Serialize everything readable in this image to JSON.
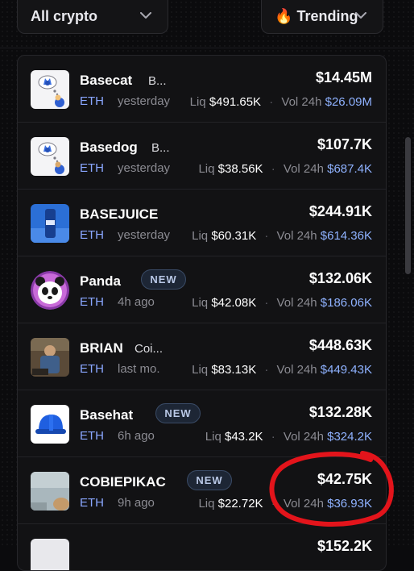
{
  "filters": {
    "crypto": {
      "label": "All crypto",
      "icon": "chevron-down-icon"
    },
    "sort": {
      "emoji": "🔥",
      "label": "Trending",
      "icon": "chevron-down-icon"
    }
  },
  "labels": {
    "liq": "Liq",
    "vol": "Vol 24h"
  },
  "tokens": [
    {
      "name": "Basecat",
      "tagline": "B...",
      "chain": "ETH",
      "age": "yesterday",
      "market_cap": "$14.45M",
      "liq": "$491.65K",
      "vol24h": "$26.09M",
      "is_new": false,
      "avatar_icon": "basecat-avatar-icon"
    },
    {
      "name": "Basedog",
      "tagline": "B...",
      "chain": "ETH",
      "age": "yesterday",
      "market_cap": "$107.7K",
      "liq": "$38.56K",
      "vol24h": "$687.4K",
      "is_new": false,
      "avatar_icon": "basedog-avatar-icon"
    },
    {
      "name": "BASEJUICE",
      "tagline": "",
      "chain": "ETH",
      "age": "yesterday",
      "market_cap": "$244.91K",
      "liq": "$60.31K",
      "vol24h": "$614.36K",
      "is_new": false,
      "avatar_icon": "basejuice-avatar-icon"
    },
    {
      "name": "Panda",
      "tagline": "",
      "chain": "ETH",
      "age": "4h ago",
      "market_cap": "$132.06K",
      "liq": "$42.08K",
      "vol24h": "$186.06K",
      "is_new": true,
      "badge": "NEW",
      "avatar_icon": "panda-avatar-icon"
    },
    {
      "name": "BRIAN",
      "tagline": "Coi...",
      "chain": "ETH",
      "age": "last mo.",
      "market_cap": "$448.63K",
      "liq": "$83.13K",
      "vol24h": "$449.43K",
      "is_new": false,
      "avatar_icon": "brian-avatar-icon"
    },
    {
      "name": "Basehat",
      "tagline": "",
      "chain": "ETH",
      "age": "6h ago",
      "market_cap": "$132.28K",
      "liq": "$43.2K",
      "vol24h": "$324.2K",
      "is_new": true,
      "badge": "NEW",
      "avatar_icon": "basehat-avatar-icon"
    },
    {
      "name": "COBIEPIKAC",
      "tagline": "",
      "chain": "ETH",
      "age": "9h ago",
      "market_cap": "$42.75K",
      "liq": "$22.72K",
      "vol24h": "$36.93K",
      "is_new": true,
      "badge": "NEW",
      "avatar_icon": "cobiepikac-avatar-icon"
    },
    {
      "name": "",
      "tagline": "",
      "chain": "",
      "age": "",
      "market_cap": "$152.2K",
      "liq": "",
      "vol24h": "",
      "is_new": false,
      "avatar_icon": "token-avatar-icon"
    }
  ],
  "annotation": {
    "color": "#e3141b",
    "icon": "red-circle-annotation"
  }
}
